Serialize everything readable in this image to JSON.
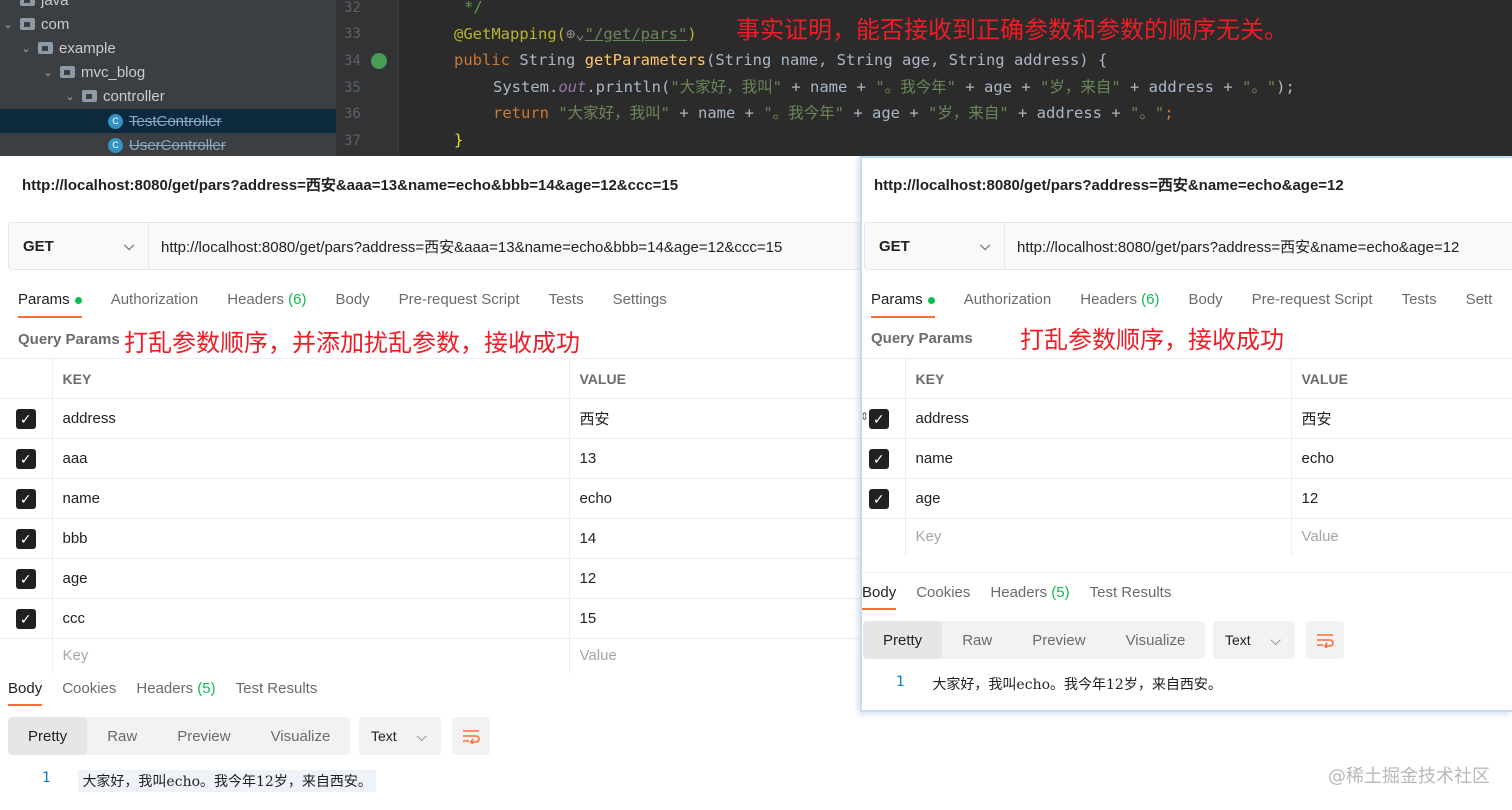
{
  "ide": {
    "tree": [
      {
        "label": "java"
      },
      {
        "label": "com"
      },
      {
        "label": "example"
      },
      {
        "label": "mvc_blog"
      },
      {
        "label": "controller"
      },
      {
        "label": "TestController"
      },
      {
        "label": "UserController"
      }
    ],
    "line_numbers": [
      "32",
      "33",
      "34",
      "35",
      "36",
      "37"
    ],
    "code": {
      "l32": "*/",
      "l33_ann": "@GetMapping(",
      "l33_url": "\"/get/pars\"",
      "l33_close": ")",
      "l34_kw": "public",
      "l34_type": "String",
      "l34_fn": "getParameters",
      "l34_args": "(String name, String age, String address) {",
      "l35_a": "System.",
      "l35_out": "out",
      "l35_b": ".println(",
      "l35_s1": "\"大家好，我叫\"",
      "l35_c": " + name + ",
      "l35_s2": "\"。我今年\"",
      "l35_d": " + age + ",
      "l35_s3": "\"岁，来自\"",
      "l35_e": " + address + ",
      "l35_s4": "\"。\"",
      "l35_f": ");",
      "l36_kw": "return",
      "l36_s1": "\"大家好，我叫\"",
      "l36_c": " + name + ",
      "l36_s2": "\"。我今年\"",
      "l36_d": " + age + ",
      "l36_s3": "\"岁，来自\"",
      "l36_e": " + address + ",
      "l36_s4": "\"。\"",
      "l36_f": ";",
      "l37": "}"
    },
    "annotation": "事实证明，能否接收到正确参数和参数的顺序无关。"
  },
  "left": {
    "title": "http://localhost:8080/get/pars?address=西安&aaa=13&name=echo&bbb=14&age=12&ccc=15",
    "method": "GET",
    "url": "http://localhost:8080/get/pars?address=西安&aaa=13&name=echo&bbb=14&age=12&ccc=15",
    "tabs": {
      "params": "Params",
      "authorization": "Authorization",
      "headers": "Headers",
      "headers_count": "(6)",
      "body": "Body",
      "prerequest": "Pre-request Script",
      "tests": "Tests",
      "settings": "Settings"
    },
    "query_params": "Query Params",
    "note": "打乱参数顺序，并添加扰乱参数，接收成功",
    "table_head": {
      "key": "KEY",
      "value": "VALUE"
    },
    "rows": [
      {
        "key": "address",
        "value": "西安"
      },
      {
        "key": "aaa",
        "value": "13"
      },
      {
        "key": "name",
        "value": "echo"
      },
      {
        "key": "bbb",
        "value": "14"
      },
      {
        "key": "age",
        "value": "12"
      },
      {
        "key": "ccc",
        "value": "15"
      }
    ],
    "placeholder": {
      "key": "Key",
      "value": "Value"
    },
    "resp_tabs": {
      "body": "Body",
      "cookies": "Cookies",
      "headers": "Headers",
      "headers_count": "(5)",
      "test_results": "Test Results"
    },
    "view": {
      "pretty": "Pretty",
      "raw": "Raw",
      "preview": "Preview",
      "visualize": "Visualize",
      "format": "Text"
    },
    "response": {
      "line": "1",
      "text": "大家好，我叫echo。我今年12岁，来自西安。"
    }
  },
  "right": {
    "title": "http://localhost:8080/get/pars?address=西安&name=echo&age=12",
    "method": "GET",
    "url": "http://localhost:8080/get/pars?address=西安&name=echo&age=12",
    "tabs": {
      "params": "Params",
      "authorization": "Authorization",
      "headers": "Headers",
      "headers_count": "(6)",
      "body": "Body",
      "prerequest": "Pre-request Script",
      "tests": "Tests",
      "settings": "Sett"
    },
    "query_params": "Query Params",
    "note": "打乱参数顺序，接收成功",
    "table_head": {
      "key": "KEY",
      "value": "VALUE"
    },
    "rows": [
      {
        "key": "address",
        "value": "西安"
      },
      {
        "key": "name",
        "value": "echo"
      },
      {
        "key": "age",
        "value": "12"
      }
    ],
    "placeholder": {
      "key": "Key",
      "value": "Value"
    },
    "resp_tabs": {
      "body": "Body",
      "cookies": "Cookies",
      "headers": "Headers",
      "headers_count": "(5)",
      "test_results": "Test Results"
    },
    "view": {
      "pretty": "Pretty",
      "raw": "Raw",
      "preview": "Preview",
      "visualize": "Visualize",
      "format": "Text"
    },
    "response": {
      "line": "1",
      "text": "大家好，我叫echo。我今年12岁，来自西安。"
    }
  },
  "watermark": "@稀土掘金技术社区",
  "colors": {
    "accent": "#ff6c37",
    "annotation": "#ee1c25",
    "active_dot": "#0cbb52"
  }
}
